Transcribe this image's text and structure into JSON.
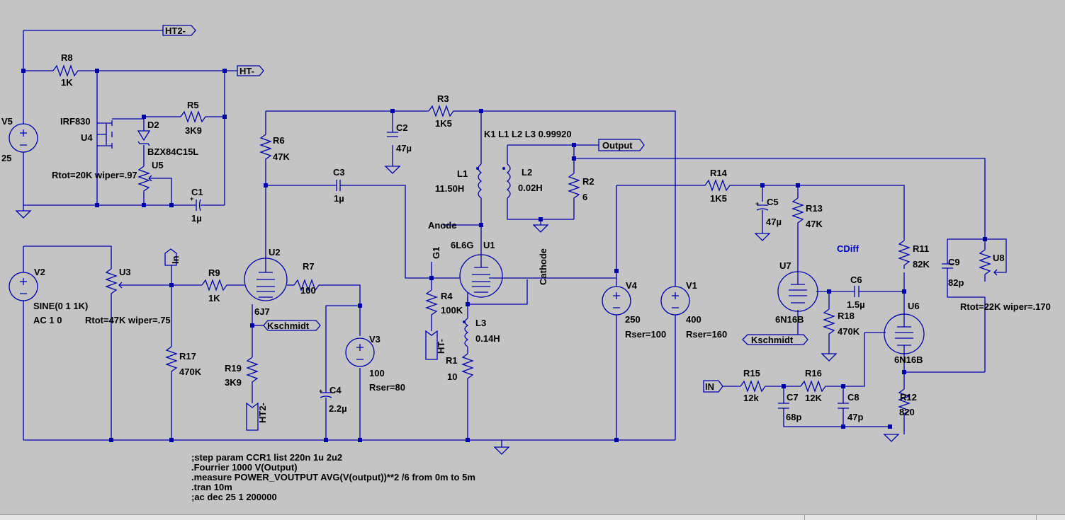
{
  "components": {
    "v5": {
      "ref": "V5",
      "value": "25"
    },
    "r8": {
      "ref": "R8",
      "value": "1K"
    },
    "u4": {
      "ref": "U4",
      "value": "IRF830"
    },
    "d2": {
      "ref": "D2",
      "value": "BZX84C15L"
    },
    "r5": {
      "ref": "R5",
      "value": "3K9"
    },
    "u5": {
      "ref": "U5",
      "value": "Rtot=20K wiper=.97"
    },
    "c1": {
      "ref": "C1",
      "value": "1µ"
    },
    "r6": {
      "ref": "R6",
      "value": "47K"
    },
    "c2": {
      "ref": "C2",
      "value": "47µ"
    },
    "r3": {
      "ref": "R3",
      "value": "1K5"
    },
    "c3": {
      "ref": "C3",
      "value": "1µ"
    },
    "l1": {
      "ref": "L1",
      "value": "11.50H"
    },
    "l2": {
      "ref": "L2",
      "value": "0.02H"
    },
    "r2": {
      "ref": "R2",
      "value": "6"
    },
    "v2": {
      "ref": "V2",
      "value": "SINE(0 1 1K)",
      "value2": "AC 1 0"
    },
    "u3": {
      "ref": "U3",
      "value": "Rtot=47K wiper=.75"
    },
    "r9": {
      "ref": "R9",
      "value": "1K"
    },
    "u2": {
      "ref": "U2",
      "value": "6J7"
    },
    "r7": {
      "ref": "R7",
      "value": "100"
    },
    "r17": {
      "ref": "R17",
      "value": "470K"
    },
    "r19": {
      "ref": "R19",
      "value": "3K9"
    },
    "c4": {
      "ref": "C4",
      "value": "2.2µ"
    },
    "v3": {
      "ref": "V3",
      "value": "100",
      "value2": "Rser=80"
    },
    "u1": {
      "ref": "U1",
      "value": "6L6G"
    },
    "r4": {
      "ref": "R4",
      "value": "100K"
    },
    "l3": {
      "ref": "L3",
      "value": "0.14H"
    },
    "r1": {
      "ref": "R1",
      "value": "10"
    },
    "v4": {
      "ref": "V4",
      "value": "250",
      "value2": "Rser=100"
    },
    "v1": {
      "ref": "V1",
      "value": "400",
      "value2": "Rser=160"
    },
    "r14": {
      "ref": "R14",
      "value": "1K5"
    },
    "c5": {
      "ref": "C5",
      "value": "47µ"
    },
    "r13": {
      "ref": "R13",
      "value": "47K"
    },
    "u7": {
      "ref": "U7",
      "value": "6N16B"
    },
    "c6": {
      "ref": "C6",
      "value": "1.5µ"
    },
    "r18": {
      "ref": "R18",
      "value": "470K"
    },
    "r11": {
      "ref": "R11",
      "value": "82K"
    },
    "c9": {
      "ref": "C9",
      "value": "82p"
    },
    "u8": {
      "ref": "U8",
      "value": "Rtot=22K wiper=.170"
    },
    "u6": {
      "ref": "U6",
      "value": "6N16B"
    },
    "r15": {
      "ref": "R15",
      "value": "12k"
    },
    "r16": {
      "ref": "R16",
      "value": "12K"
    },
    "c7": {
      "ref": "C7",
      "value": "68p"
    },
    "c8": {
      "ref": "C8",
      "value": "47p"
    },
    "r12": {
      "ref": "R12",
      "value": "820"
    }
  },
  "coupling": "K1 L1 L2 L3 0.99920",
  "net_labels": {
    "ht2_top": "HT2-",
    "ht_top": "HT-",
    "output": "Output",
    "in_a": "In",
    "kschmidt_a": "Kschmidt",
    "ht_mid": "HT-",
    "ht2_bottom": "HT2-",
    "kschmidt_b": "Kschmidt",
    "in_b": "IN",
    "anode": "Anode",
    "g1": "G1",
    "cathode": "Cathode",
    "cdiff": "CDiff"
  },
  "directives": [
    ";step param CCR1 list 220n 1u 2u2",
    ".Fourrier 1000 V(Output)",
    ".measure POWER_VOUTPUT AVG(V(output))**2 /6 from 0m to 5m",
    ".tran 10m",
    ";ac dec 25 1 200000"
  ],
  "colors": {
    "background": "#c4c4c4",
    "wire": "#0000aa",
    "text": "#000000",
    "comment": "#0000cc"
  }
}
